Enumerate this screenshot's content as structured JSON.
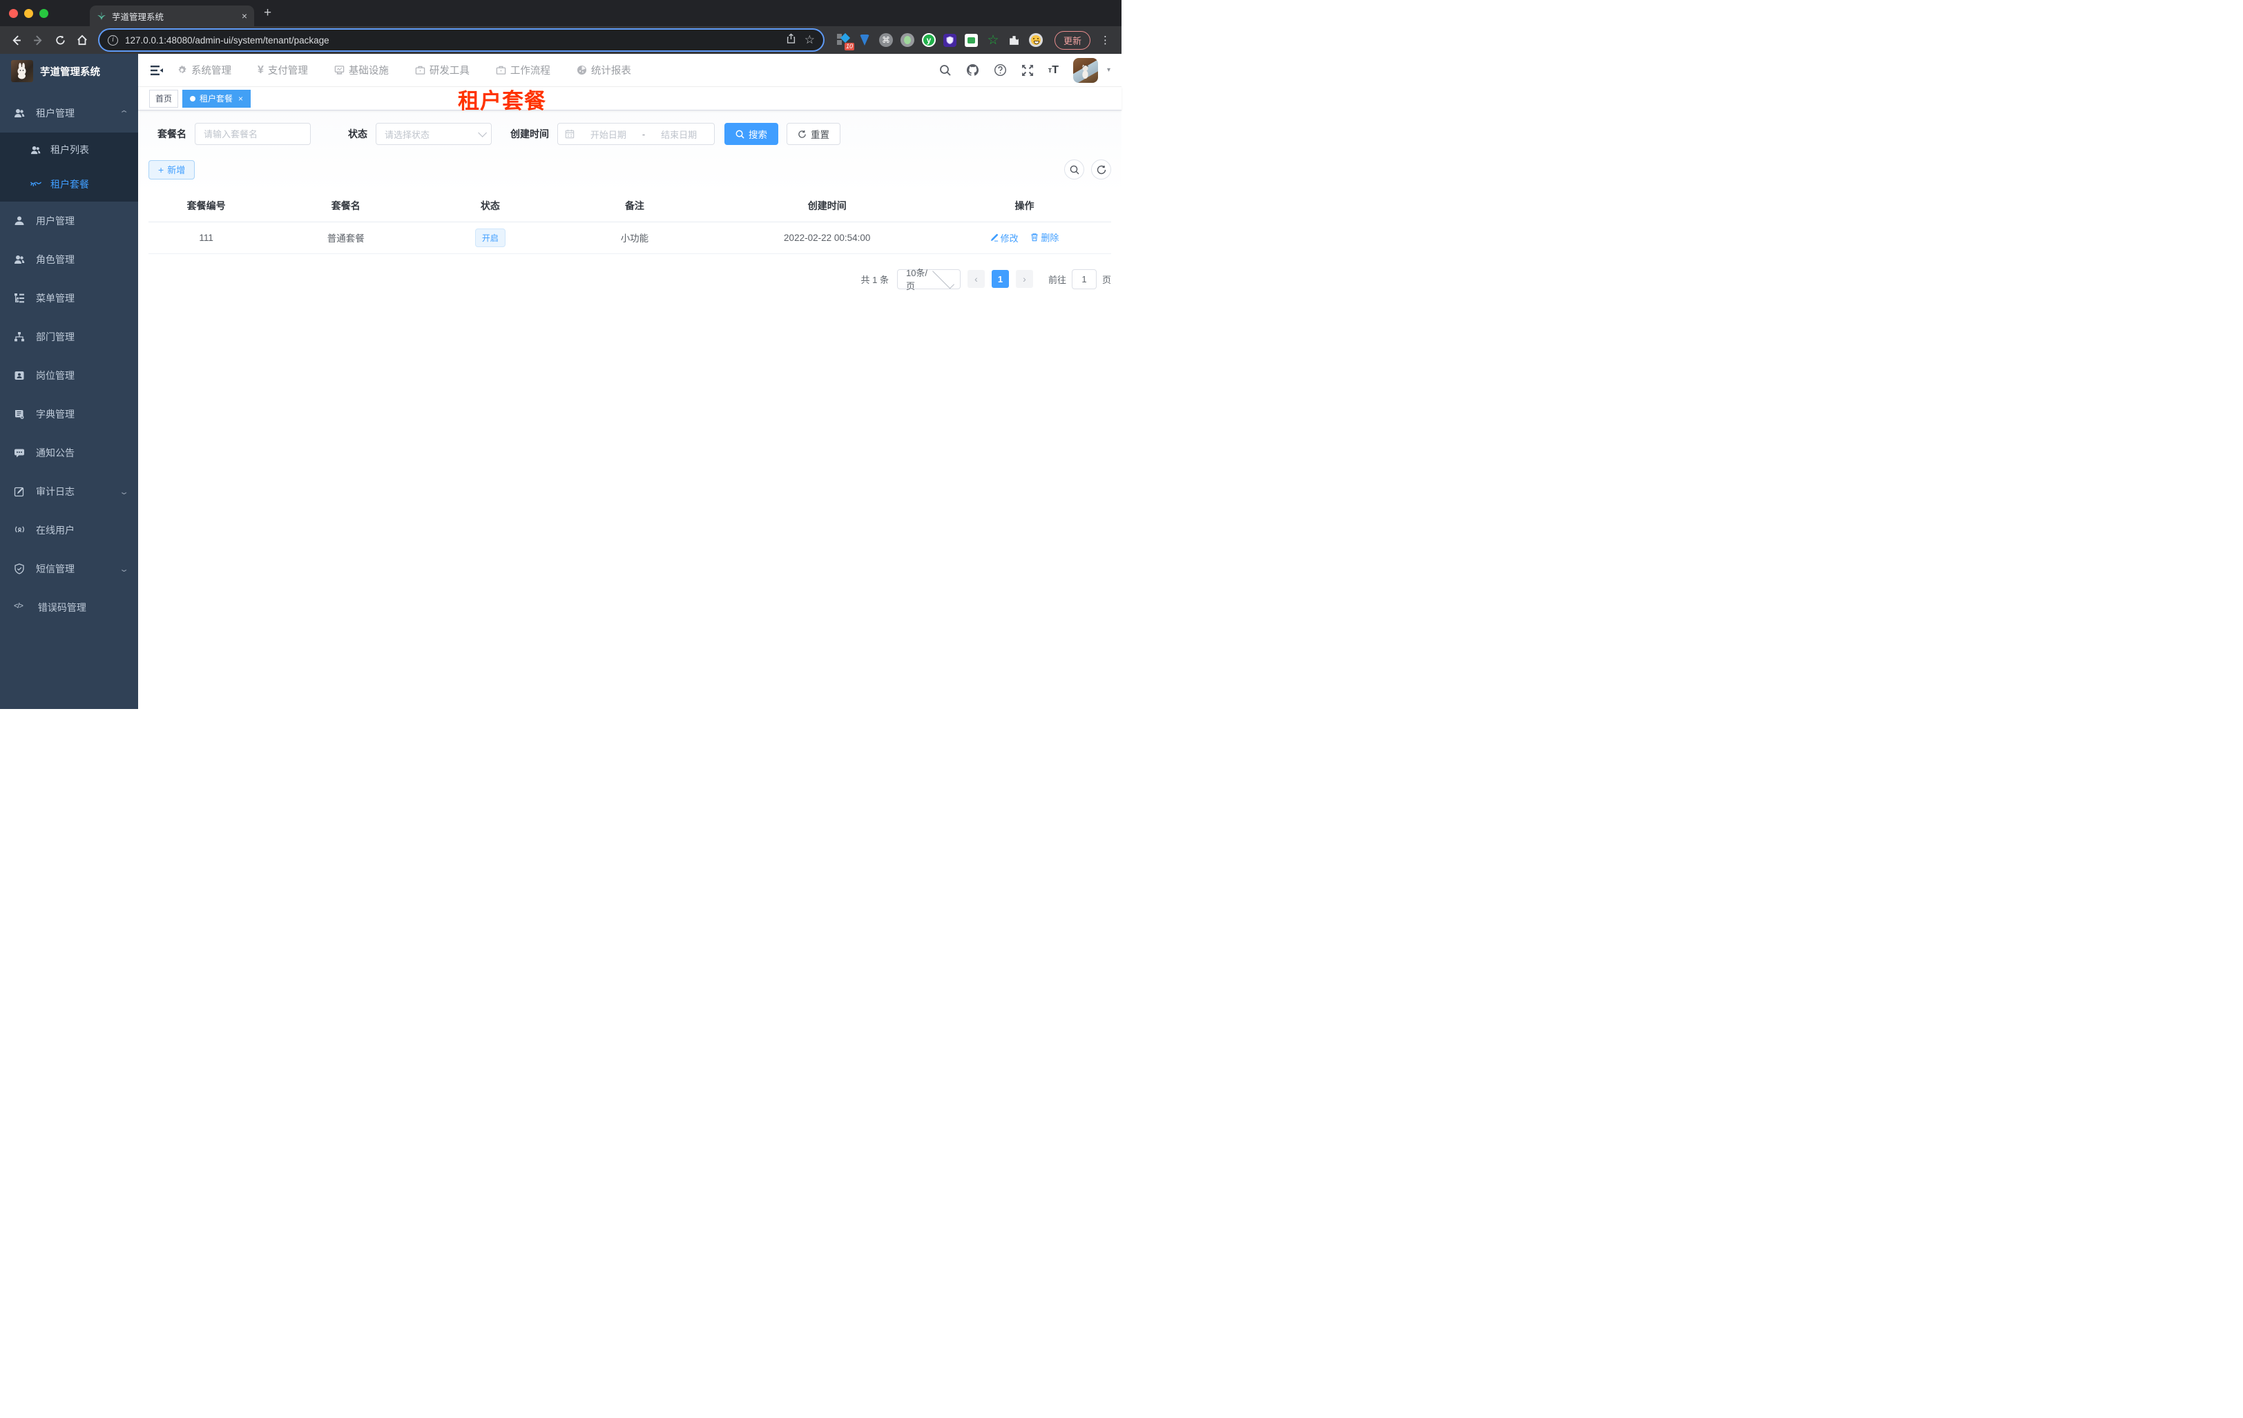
{
  "browser": {
    "tab_title": "芋道管理系统",
    "url": "127.0.0.1:48080/admin-ui/system/tenant/package",
    "ext_badge": "10",
    "update_label": "更新"
  },
  "glyphs": {
    "close": "×",
    "newtab": "+",
    "plus": "+",
    "yen": "¥",
    "question": "?",
    "command": "⌘",
    "ext_y": "y",
    "star": "☆",
    "kebab": "⋮",
    "info": "i",
    "chevron_left": "‹",
    "chevron_right": "›",
    "caret_up": "⌃",
    "caret_down": "⌄",
    "caret_small": "▾",
    "code": "</>",
    "font_small": "т",
    "font_big": "T"
  },
  "app": {
    "sidebar": {
      "title": "芋道管理系统",
      "group_tenant": "租户管理",
      "tenant_list": "租户列表",
      "tenant_package": "租户套餐",
      "items": [
        "用户管理",
        "角色管理",
        "菜单管理",
        "部门管理",
        "岗位管理",
        "字典管理",
        "通知公告",
        "审计日志",
        "在线用户",
        "短信管理",
        "错误码管理"
      ]
    },
    "topnav": {
      "items": [
        "系统管理",
        "支付管理",
        "基础设施",
        "研发工具",
        "工作流程",
        "统计报表"
      ]
    },
    "tags": {
      "home": "首页",
      "active": "租户套餐"
    },
    "overlay_title": "租户套餐",
    "filters": {
      "name_label": "套餐名",
      "name_placeholder": "请输入套餐名",
      "status_label": "状态",
      "status_placeholder": "请选择状态",
      "date_label": "创建时间",
      "date_start": "开始日期",
      "date_separator": "-",
      "date_end": "结束日期",
      "search_label": "搜索",
      "reset_label": "重置",
      "add_label": "新增"
    },
    "table": {
      "headers": [
        "套餐编号",
        "套餐名",
        "状态",
        "备注",
        "创建时间",
        "操作"
      ],
      "rows": [
        {
          "id": "111",
          "name": "普通套餐",
          "status": "开启",
          "remark": "小功能",
          "created": "2022-02-22 00:54:00",
          "edit": "修改",
          "delete": "删除"
        }
      ]
    },
    "pagination": {
      "total": "共 1 条",
      "page_size": "10条/页",
      "page": "1",
      "goto_label": "前往",
      "goto_value": "1",
      "page_suffix": "页"
    }
  },
  "colors": {
    "accent": "#409eff",
    "overlay_red": "#ff3300",
    "sidebar_bg": "#304156",
    "submenu_bg": "#1f2d3d",
    "sidebar_text": "#bfcbd9",
    "status_tag_bg": "#e9f4fe",
    "tag_active_bg": "#42a0f5"
  }
}
